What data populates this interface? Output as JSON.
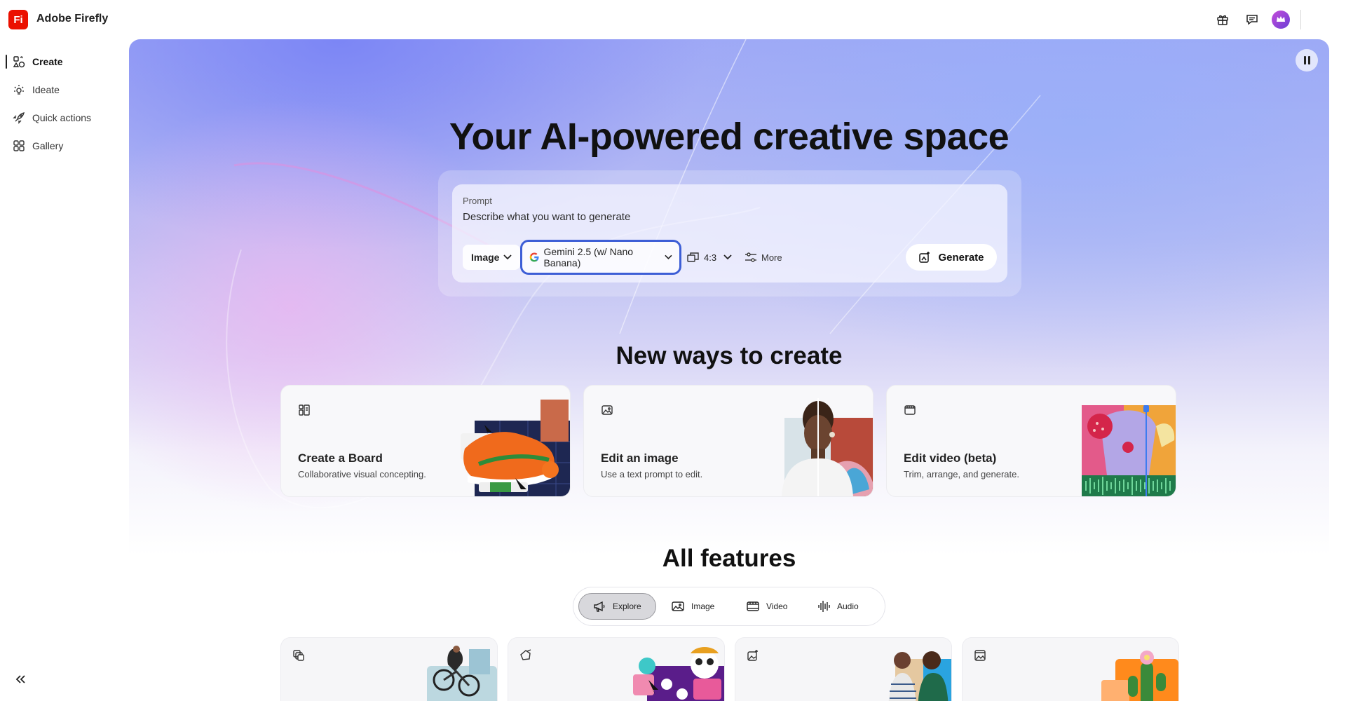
{
  "app": {
    "logo_text": "Fi",
    "title": "Adobe Firefly",
    "brand_color": "#eb1000"
  },
  "header": {
    "icons": [
      "gift-icon",
      "chat-bubble-icon",
      "crown-avatar-icon"
    ]
  },
  "sidebar": {
    "items": [
      {
        "label": "Create",
        "icon": "create-icon",
        "active": true
      },
      {
        "label": "Ideate",
        "icon": "sparkle-icon",
        "active": false
      },
      {
        "label": "Quick actions",
        "icon": "rocket-icon",
        "active": false
      },
      {
        "label": "Gallery",
        "icon": "grid-icon",
        "active": false
      }
    ],
    "collapse_icon": "double-chevron-left-icon"
  },
  "hero": {
    "title": "Your AI-powered creative space",
    "prompt": {
      "label": "Prompt",
      "placeholder": "Describe what you want to generate",
      "value": ""
    },
    "controls": {
      "type": "Image",
      "model": "Gemini 2.5 (w/ Nano Banana)",
      "aspect_ratio": "4:3",
      "more": "More",
      "generate": "Generate"
    },
    "focus_color": "#3d5ed6"
  },
  "new_ways": {
    "title": "New ways to create",
    "cards": [
      {
        "title": "Create a Board",
        "description": "Collaborative visual concepting.",
        "icon": "board-icon"
      },
      {
        "title": "Edit an image",
        "description": "Use a text prompt to edit.",
        "icon": "image-icon"
      },
      {
        "title": "Edit video (beta)",
        "description": "Trim, arrange, and generate.",
        "icon": "film-icon"
      }
    ]
  },
  "all_features": {
    "title": "All features",
    "tabs": [
      {
        "label": "Explore",
        "icon": "megaphone-icon",
        "active": true
      },
      {
        "label": "Image",
        "icon": "image-icon",
        "active": false
      },
      {
        "label": "Video",
        "icon": "film-icon",
        "active": false
      },
      {
        "label": "Audio",
        "icon": "waveform-icon",
        "active": false
      }
    ],
    "cards": [
      {
        "icon": "layers-icon"
      },
      {
        "icon": "shape-edit-icon"
      },
      {
        "icon": "generate-image-icon"
      },
      {
        "icon": "film-image-icon"
      }
    ]
  }
}
